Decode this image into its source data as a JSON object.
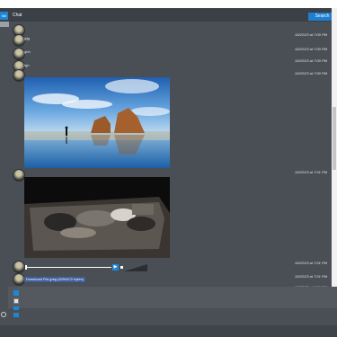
{
  "tabs": {
    "left": "Me",
    "chat": "Chat"
  },
  "search_label": "Search",
  "messages": [
    {
      "name": "",
      "time": "10/22/23 at 7:00 PM"
    },
    {
      "name": "jpjg",
      "time": "10/22/23 at 7:00 PM"
    },
    {
      "name": "ghh",
      "time": "10/22/23 at 7:00 PM"
    },
    {
      "name": "fgh",
      "time": "10/22/23 at 7:00 PM"
    },
    {
      "name": "",
      "time": ""
    },
    {
      "name": "",
      "time": "10/22/23 at 7:01 PM"
    },
    {
      "name": "",
      "time": "10/22/23 at 7:01 PM"
    },
    {
      "name": "",
      "time": "10/22/23 at 7:01 PM"
    },
    {
      "name": "",
      "time": "10/22/23 at 7:01 PM"
    }
  ],
  "download_label": "Download File.jpeg (6294472 bytes)",
  "icons": {
    "play": "play-icon",
    "attach": "attachment-icon",
    "image": "image-icon",
    "send": "send-icon"
  },
  "colors": {
    "accent": "#1e86d6",
    "background": "#4a4f56"
  }
}
